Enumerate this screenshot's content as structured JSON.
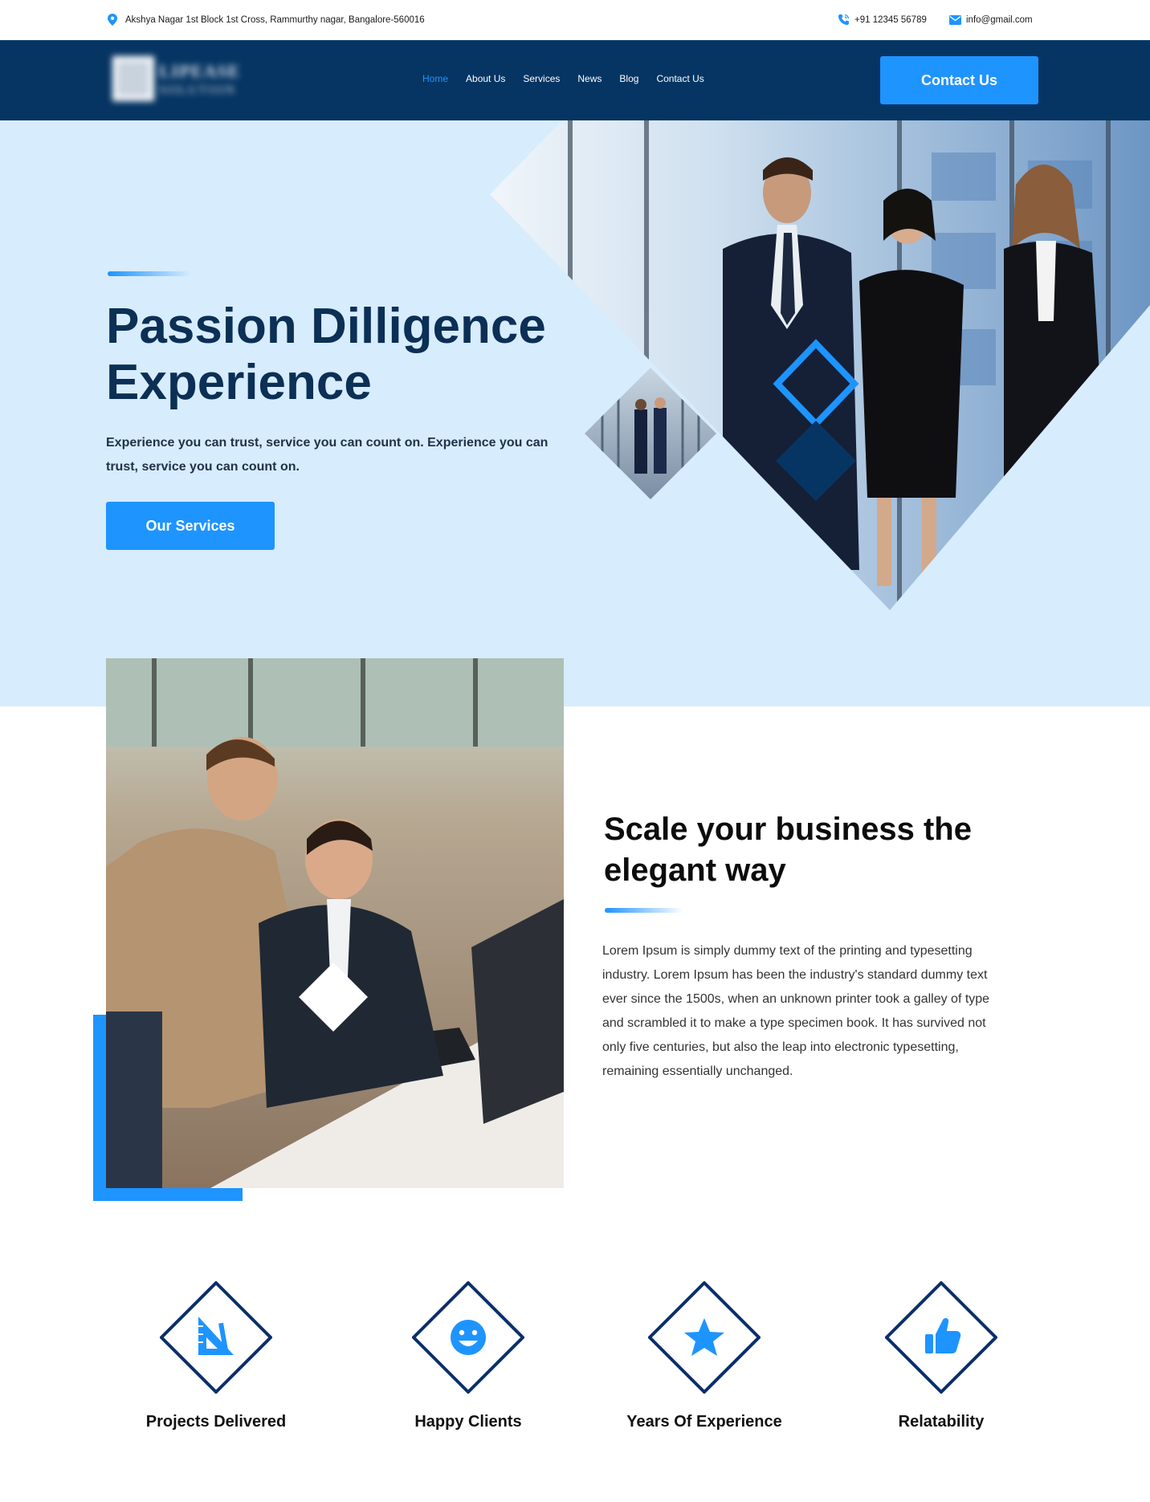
{
  "topbar": {
    "address": "Akshya Nagar 1st Block 1st Cross, Rammurthy nagar, Bangalore-560016",
    "phone": "+91 12345 56789",
    "email": "info@gmail.com",
    "icons": [
      "location-pin-icon",
      "phone-icon",
      "mail-icon"
    ]
  },
  "nav": {
    "logo_text": [
      "LIPEASE",
      "SOLUTION"
    ],
    "links": [
      {
        "label": "Home",
        "active": true
      },
      {
        "label": "About Us",
        "active": false
      },
      {
        "label": "Services",
        "active": false
      },
      {
        "label": "News",
        "active": false
      },
      {
        "label": "Blog",
        "active": false
      },
      {
        "label": "Contact Us",
        "active": false
      }
    ],
    "cta_label": "Contact Us"
  },
  "hero": {
    "title": "Passion Dilligence Experience",
    "subtitle": "Experience you can trust, service you can count on. Experience you can trust, service you can count on.",
    "button_label": "Our Services"
  },
  "about": {
    "title": "Scale your business the elegant way",
    "body": "Lorem Ipsum is simply dummy text of the printing and typesetting industry. Lorem Ipsum has been the industry's standard dummy text ever since the 1500s, when an unknown printer took a galley of type and scrambled it to make a type specimen book. It has survived not only five centuries, but also the leap into electronic typesetting, remaining essentially unchanged."
  },
  "features": [
    {
      "label": "Projects Delivered",
      "icon": "ruler-triangle-icon"
    },
    {
      "label": "Happy Clients",
      "icon": "smiley-face-icon"
    },
    {
      "label": "Years Of Experience",
      "icon": "star-icon"
    },
    {
      "label": "Relatability",
      "icon": "thumbs-up-icon"
    }
  ],
  "colors": {
    "navy": "#063563",
    "accent": "#1e94ff",
    "hero_bg": "#d7ecfc",
    "heading": "#0b2f55"
  }
}
